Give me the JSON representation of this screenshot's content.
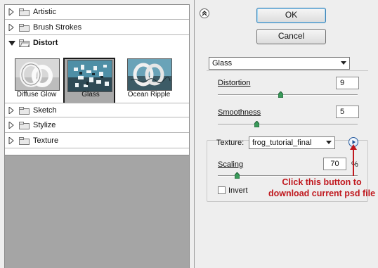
{
  "gallery": {
    "categories_top": [
      {
        "label": "Artistic",
        "expanded": false
      },
      {
        "label": "Brush Strokes",
        "expanded": false
      },
      {
        "label": "Distort",
        "expanded": true
      }
    ],
    "thumbnails": [
      {
        "label": "Diffuse Glow",
        "selected": false
      },
      {
        "label": "Glass",
        "selected": true
      },
      {
        "label": "Ocean Ripple",
        "selected": false
      }
    ],
    "categories_bottom": [
      {
        "label": "Sketch",
        "expanded": false
      },
      {
        "label": "Stylize",
        "expanded": false
      },
      {
        "label": "Texture",
        "expanded": false
      }
    ]
  },
  "buttons": {
    "ok": "OK",
    "cancel": "Cancel"
  },
  "filter_select": {
    "value": "Glass"
  },
  "options": {
    "distortion_label": "Distortion",
    "distortion_value": "9",
    "distortion_level": 0.45,
    "smoothness_label": "Smoothness",
    "smoothness_value": "5",
    "smoothness_level": 0.28,
    "texture_label": "Texture:",
    "texture_value": "frog_tutorial_final",
    "scaling_label": "Scaling",
    "scaling_value": "70",
    "scaling_unit": "%",
    "scaling_level": 0.14,
    "invert_label": "Invert",
    "invert_checked": false
  },
  "annotation": {
    "line1": "Click this button to",
    "line2": "download current psd file",
    "color": "#c0181e"
  },
  "colors": {
    "selected_thumb_bg": "#a9a9a9",
    "gallery_empty_bg": "#a5a5a5",
    "knob_green": "#3a9a5a"
  }
}
